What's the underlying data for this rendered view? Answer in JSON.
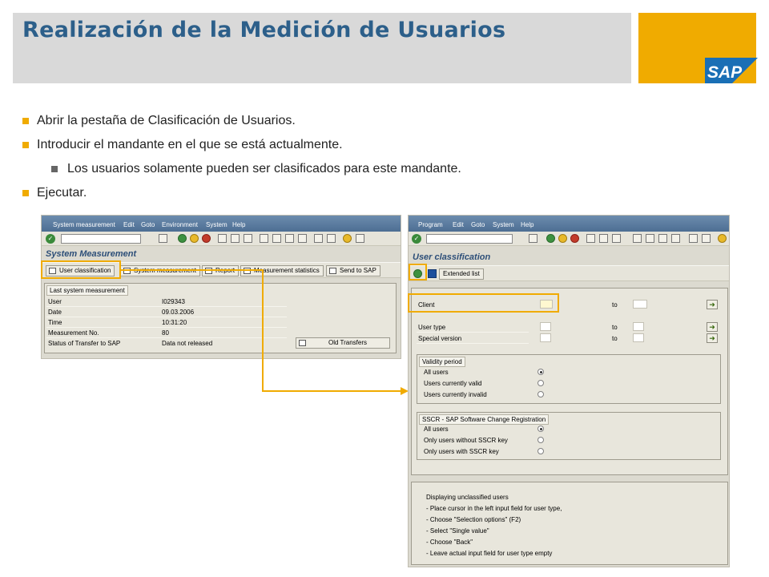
{
  "slide": {
    "title": "Realización de la Medición de Usuarios",
    "bullets": [
      "Abrir la pestaña de Clasificación de Usuarios.",
      "Introducir el mandante en el que se está actualmente."
    ],
    "sub_bullet": "Los usuarios solamente pueden ser clasificados para este mandante.",
    "last_bullet": "Ejecutar."
  },
  "left_screen": {
    "menu": [
      "System measurement",
      "Edit",
      "Goto",
      "Environment",
      "System",
      "Help"
    ],
    "title": "System Measurement",
    "buttons": [
      "User classification",
      "System measurement",
      "Report",
      "Measurement statistics",
      "Send to SAP"
    ],
    "group_title": "Last system measurement",
    "rows": [
      {
        "label": "User",
        "value": "I029343"
      },
      {
        "label": "Date",
        "value": "09.03.2006"
      },
      {
        "label": "Time",
        "value": "10:31:20"
      },
      {
        "label": "Measurement No.",
        "value": "80"
      },
      {
        "label": "Status of Transfer to SAP",
        "value": "Data not released"
      }
    ],
    "old_transfers": "Old Transfers"
  },
  "right_screen": {
    "menu": [
      "Program",
      "Edit",
      "Goto",
      "System",
      "Help"
    ],
    "title": "User classification",
    "extended_list": "Extended list",
    "client_label": "Client",
    "user_type_label": "User type",
    "special_version_label": "Special version",
    "to_label": "to",
    "validity_title": "Validity period",
    "validity_options": [
      "All users",
      "Users currently valid",
      "Users currently invalid"
    ],
    "sscr_title": "SSCR - SAP Software Change Registration",
    "sscr_options": [
      "All users",
      "Only users without SSCR key",
      "Only users with SSCR key"
    ],
    "info_lines": [
      "Displaying unclassified users",
      "- Place cursor in the left input field for user type,",
      "- Choose \"Selection options\" (F2)",
      "- Select \"Single value\"",
      "- Choose \"Back\"",
      "- Leave actual input field for user type empty"
    ]
  },
  "colors": {
    "accent": "#f0ab00",
    "title": "#2c5f8a",
    "header_band": "#d9d9d9"
  }
}
